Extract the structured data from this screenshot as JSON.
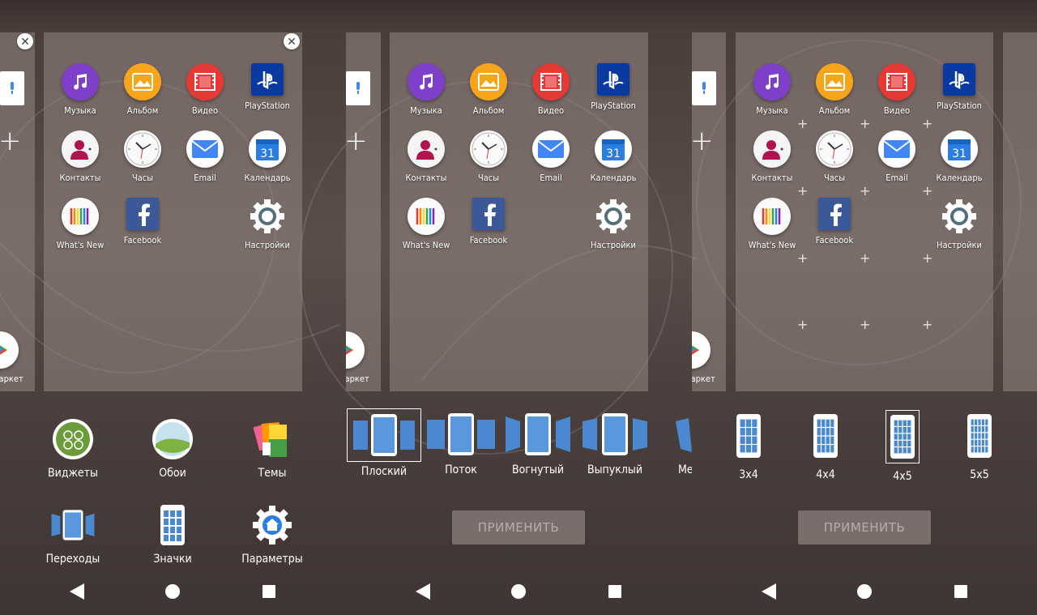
{
  "colors": {
    "music": "#7e3fc9",
    "album": "#f6a51a",
    "video": "#e53935",
    "playstation": "#0a3aa0",
    "contacts": "#f5f5f5",
    "email": "#ffffff",
    "calendar": "#ffffff",
    "facebook": "#3b5998",
    "apply_bg": "#8c807e"
  },
  "panels": [
    {
      "apps": [
        {
          "icon": "music-icon",
          "label": "Музыка"
        },
        {
          "icon": "album-icon",
          "label": "Альбом"
        },
        {
          "icon": "video-icon",
          "label": "Видео"
        },
        {
          "icon": "playstation-icon",
          "label": "PlayStation"
        },
        {
          "icon": "contacts-icon",
          "label": "Контакты"
        },
        {
          "icon": "clock-icon",
          "label": "Часы"
        },
        {
          "icon": "email-icon",
          "label": "Email"
        },
        {
          "icon": "calendar-icon",
          "label": "Календарь",
          "day": "31"
        },
        {
          "icon": "whatsnew-icon",
          "label": "What's New"
        },
        {
          "icon": "facebook-icon",
          "label": "Facebook"
        },
        {
          "icon": "settings-icon",
          "label": "Настройки"
        }
      ],
      "peek_label": "Маркет",
      "menu": [
        {
          "icon": "widgets-icon",
          "label": "Виджеты"
        },
        {
          "icon": "wallpaper-icon",
          "label": "Обои"
        },
        {
          "icon": "themes-icon",
          "label": "Темы"
        },
        {
          "icon": "transitions-icon",
          "label": "Переходы"
        },
        {
          "icon": "icons-grid-icon",
          "label": "Значки"
        },
        {
          "icon": "home-settings-icon",
          "label": "Параметры"
        }
      ]
    },
    {
      "apps": [
        {
          "icon": "music-icon",
          "label": "Музыка"
        },
        {
          "icon": "album-icon",
          "label": "Альбом"
        },
        {
          "icon": "video-icon",
          "label": "Видео"
        },
        {
          "icon": "playstation-icon",
          "label": "PlayStation"
        },
        {
          "icon": "contacts-icon",
          "label": "Контакты"
        },
        {
          "icon": "clock-icon",
          "label": "Часы"
        },
        {
          "icon": "email-icon",
          "label": "Email"
        },
        {
          "icon": "calendar-icon",
          "label": "Календарь",
          "day": "31"
        },
        {
          "icon": "whatsnew-icon",
          "label": "What's New"
        },
        {
          "icon": "facebook-icon",
          "label": "Facebook"
        },
        {
          "icon": "settings-icon",
          "label": "Настройки"
        }
      ],
      "peek_label": "Маркет",
      "transitions": [
        {
          "label": "Плоский",
          "selected": true
        },
        {
          "label": "Поток",
          "selected": false
        },
        {
          "label": "Вогнутый",
          "selected": false
        },
        {
          "label": "Выпуклый",
          "selected": false
        },
        {
          "label": "Мель",
          "selected": false
        }
      ],
      "apply_label": "ПРИМЕНИТЬ"
    },
    {
      "apps": [
        {
          "icon": "music-icon",
          "label": "Музыка"
        },
        {
          "icon": "album-icon",
          "label": "Альбом"
        },
        {
          "icon": "video-icon",
          "label": "Видео"
        },
        {
          "icon": "playstation-icon",
          "label": "PlayStation"
        },
        {
          "icon": "contacts-icon",
          "label": "Контакты"
        },
        {
          "icon": "clock-icon",
          "label": "Часы"
        },
        {
          "icon": "email-icon",
          "label": "Email"
        },
        {
          "icon": "calendar-icon",
          "label": "Календарь",
          "day": "31"
        },
        {
          "icon": "whatsnew-icon",
          "label": "What's New"
        },
        {
          "icon": "facebook-icon",
          "label": "Facebook"
        },
        {
          "icon": "settings-icon",
          "label": "Настройки"
        }
      ],
      "peek_label": "Маркет",
      "grids": [
        {
          "label": "3x4",
          "selected": false
        },
        {
          "label": "4x4",
          "selected": false
        },
        {
          "label": "4x5",
          "selected": true
        },
        {
          "label": "5x5",
          "selected": false
        }
      ],
      "apply_label": "ПРИМЕНИТЬ"
    }
  ],
  "close_symbol": "✕",
  "plus_symbol": "+"
}
